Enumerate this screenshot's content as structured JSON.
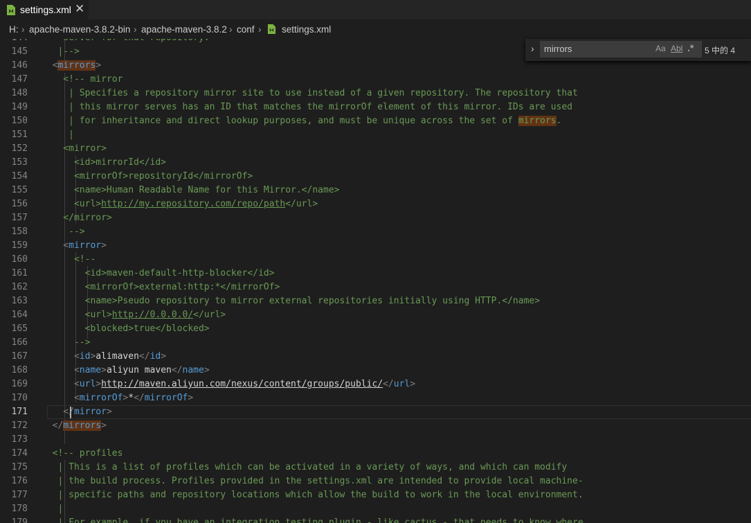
{
  "tab": {
    "title": "settings.xml",
    "close": "✕"
  },
  "breadcrumb": {
    "drive": "H:",
    "items": [
      "apache-maven-3.8.2-bin",
      "apache-maven-3.8.2",
      "conf",
      "settings.xml"
    ]
  },
  "find": {
    "query": "mirrors",
    "match_case": "Aa",
    "whole_word": "Abl",
    "regex": ".*",
    "result": "5 中的 4"
  },
  "editor": {
    "active_line": "171",
    "lines": [
      {
        "n": "144",
        "code": "    server for that repository."
      },
      {
        "n": "145",
        "code": "   |-->"
      },
      {
        "n": "146",
        "code": "  <mirrors>"
      },
      {
        "n": "147",
        "code": "    <!-- mirror"
      },
      {
        "n": "148",
        "code": "     | Specifies a repository mirror site to use instead of a given repository. The repository that"
      },
      {
        "n": "149",
        "code": "     | this mirror serves has an ID that matches the mirrorOf element of this mirror. IDs are used"
      },
      {
        "n": "150",
        "code": "     | for inheritance and direct lookup purposes, and must be unique across the set of mirrors."
      },
      {
        "n": "151",
        "code": "     |"
      },
      {
        "n": "152",
        "code": "    <mirror>"
      },
      {
        "n": "153",
        "code": "      <id>mirrorId</id>"
      },
      {
        "n": "154",
        "code": "      <mirrorOf>repositoryId</mirrorOf>"
      },
      {
        "n": "155",
        "code": "      <name>Human Readable Name for this Mirror.</name>"
      },
      {
        "n": "156",
        "code": "      <url>http://my.repository.com/repo/path</url>"
      },
      {
        "n": "157",
        "code": "    </mirror>"
      },
      {
        "n": "158",
        "code": "     -->"
      },
      {
        "n": "159",
        "code": "    <mirror>"
      },
      {
        "n": "160",
        "code": "      <!--"
      },
      {
        "n": "161",
        "code": "        <id>maven-default-http-blocker</id>"
      },
      {
        "n": "162",
        "code": "        <mirrorOf>external:http:*</mirrorOf>"
      },
      {
        "n": "163",
        "code": "        <name>Pseudo repository to mirror external repositories initially using HTTP.</name>"
      },
      {
        "n": "164",
        "code": "        <url>http://0.0.0.0/</url>"
      },
      {
        "n": "165",
        "code": "        <blocked>true</blocked>"
      },
      {
        "n": "166",
        "code": "      -->"
      },
      {
        "n": "167",
        "code": "      <id>alimaven</id>"
      },
      {
        "n": "168",
        "code": "      <name>aliyun maven</name>"
      },
      {
        "n": "169",
        "code": "      <url>http://maven.aliyun.com/nexus/content/groups/public/</url>"
      },
      {
        "n": "170",
        "code": "      <mirrorOf>*</mirrorOf>"
      },
      {
        "n": "171",
        "code": "    </mirror>"
      },
      {
        "n": "172",
        "code": "  </mirrors>"
      },
      {
        "n": "173",
        "code": ""
      },
      {
        "n": "174",
        "code": "  <!-- profiles"
      },
      {
        "n": "175",
        "code": "   | This is a list of profiles which can be activated in a variety of ways, and which can modify"
      },
      {
        "n": "176",
        "code": "   | the build process. Profiles provided in the settings.xml are intended to provide local machine-"
      },
      {
        "n": "177",
        "code": "   | specific paths and repository locations which allow the build to work in the local environment."
      },
      {
        "n": "178",
        "code": "   |"
      },
      {
        "n": "179",
        "code": "   | For example, if you have an integration testing plugin - like cactus - that needs to know where"
      }
    ]
  },
  "colors": {
    "background": "#1e1e1e",
    "comment": "#6a9955",
    "tag": "#569cd6",
    "bracket": "#808080",
    "match_highlight": "#613214"
  },
  "icons": [
    "xml-file-icon",
    "close-icon",
    "chevron-right-icon",
    "match-case-icon",
    "whole-word-icon",
    "regex-icon"
  ]
}
